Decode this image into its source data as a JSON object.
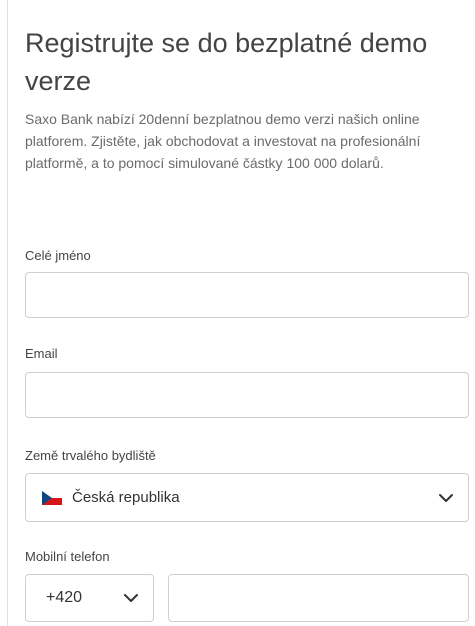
{
  "form": {
    "title": "Registrujte se do bezplatné demo verze",
    "description": "Saxo Bank nabízí 20denní bezplatnou demo verzi našich online platforem. Zjistěte, jak obchodovat a investovat na profesionální platformě, a to pomocí simulované částky 100 000 dolarů.",
    "full_name": {
      "label": "Celé jméno",
      "value": ""
    },
    "email": {
      "label": "Email",
      "value": ""
    },
    "country": {
      "label": "Země trvalého bydliště",
      "selected": "Česká republika",
      "flag_icon": "czech-flag-icon"
    },
    "phone": {
      "label": "Mobilní telefon",
      "country_code": "+420",
      "value": ""
    }
  },
  "colors": {
    "border": "#cfcfcf",
    "title_text": "#444444",
    "body_text": "#6b6b6b"
  }
}
